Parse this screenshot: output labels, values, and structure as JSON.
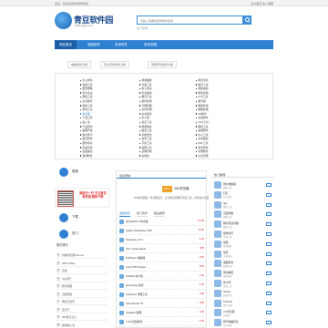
{
  "topbar": {
    "left": "您好，欢迎来到青豆软件园！",
    "right": "设为首页 加入收藏"
  },
  "logo": {
    "name": "青豆软件园",
    "url": "www.qdrjy.com"
  },
  "search": {
    "placeholder": "请输入您要搜索的软件名称"
  },
  "hotwords": "热门搜索：",
  "nav": [
    "网站首页",
    "电脑软件",
    "安卓软件",
    "资讯攻略"
  ],
  "breadcrumb": [
    "电脑软件分类",
    "安卓手机软件分类",
    "苹果手机软件分类"
  ],
  "categories": {
    "col1": [
      "办公软件",
      "系统工具",
      "图形图像",
      "安全杀毒",
      "网络工具",
      "社交聊天",
      "媒体工具",
      "游戏工具",
      "浏览器",
      "下载工具",
      "输入法",
      "行业软件",
      "编程开发",
      "教育学习",
      "股票软件",
      "硬件驱动",
      "压缩刻录",
      "桌面美化",
      "其他软件"
    ],
    "col2": [
      "视频播放",
      "音频工具",
      "电子阅读",
      "影音编辑",
      "翻译工具",
      "邮件处理",
      "日程管理",
      "文件管理",
      "杀毒软件",
      "防火墙",
      "加密工具",
      "数据恢复",
      "磁盘工具",
      "系统优化",
      "备份工具",
      "字体工具",
      "截图工具",
      "远程控制",
      "虚拟机"
    ],
    "col3": [
      "网页浏览",
      "聊天工具",
      "网络电视",
      "网盘存储",
      "FTP工具",
      "服务器",
      "网络检测",
      "图像处理",
      "3D制作",
      "动画制作",
      "CAD工具",
      "图标工具",
      "看图软件",
      "办公工具",
      "文本编辑",
      "PDF工具",
      "财务软件",
      "管理软件",
      "信息管理"
    ],
    "highlight": "浏览器"
  },
  "left": {
    "block1": "搜索",
    "block2": "热门",
    "block3": "下载",
    "qr_text": "微信扫一扫 关注青豆软件园 精彩不断",
    "list_title": "软件排行",
    "list": [
      "谷歌浏览器Chrome",
      "WPS Office",
      "迅雷",
      "QQ音乐",
      "腾讯视频",
      "百度网盘",
      "网易云音乐",
      "爱奇艺",
      "360安全卫士",
      "搜狗输入法"
    ]
  },
  "main": {
    "header": "最近更新",
    "badge": "V3.0",
    "app_name": "360浏览器",
    "desc": "360浏览器是一款功能强大、安全稳定的网页浏览工具，深受用户喜爱。",
    "tabs": [
      "最新软件",
      "热门软件",
      "精品推荐"
    ],
    "rows": [
      {
        "name": "WinRAR 5.0 中文版",
        "size": "12.5M"
      },
      {
        "name": "Adobe Photoshop CS6",
        "size": "210M"
      },
      {
        "name": "Notepad++ 8.4",
        "size": "4.2M"
      },
      {
        "name": "VLC media player",
        "size": "38M"
      },
      {
        "name": "PotPlayer 播放器",
        "size": "26M"
      },
      {
        "name": "Foxit PDF Reader",
        "size": "65M"
      },
      {
        "name": "FileZilla 客户端",
        "size": "11M"
      },
      {
        "name": "Everything 搜索",
        "size": "1.6M"
      },
      {
        "name": "CCleaner 清理工具",
        "size": "24M"
      },
      {
        "name": "TeamViewer 15",
        "size": "30M"
      },
      {
        "name": "Snipaste 截图",
        "size": "14M"
      },
      {
        "name": "7-Zip 压缩软件",
        "size": "1.5M"
      }
    ]
  },
  "right": {
    "header": "热门推荐",
    "rows": [
      {
        "name": "微信电脑版",
        "sub": "聊天工具"
      },
      {
        "name": "钉钉",
        "sub": "办公软件"
      },
      {
        "name": "QQ",
        "sub": "聊天工具"
      },
      {
        "name": "百度网盘",
        "sub": "网络工具"
      },
      {
        "name": "网易有道词典",
        "sub": "翻译工具"
      },
      {
        "name": "酷狗音乐",
        "sub": "音频工具"
      },
      {
        "name": "优酷",
        "sub": "视频播放"
      },
      {
        "name": "快压",
        "sub": "压缩刻录"
      },
      {
        "name": "美图秀秀",
        "sub": "图像处理"
      },
      {
        "name": "驱动精灵",
        "sub": "硬件驱动"
      },
      {
        "name": "鲁大师",
        "sub": "系统工具"
      },
      {
        "name": "Steam",
        "sub": "游戏平台"
      },
      {
        "name": "Foxmail",
        "sub": "邮件处理"
      },
      {
        "name": "UC浏览器",
        "sub": "浏览器"
      },
      {
        "name": "腾讯电脑管家",
        "sub": "安全杀毒"
      }
    ]
  },
  "colors": {
    "accent": "#2d80d2",
    "nav_active": "#1a5fa8",
    "badge": "#f0a12a",
    "size_text": "#dd3333"
  },
  "icons": [
    "globe-logo-icon",
    "search-icon",
    "circle-icon",
    "qr-code-icon",
    "app-icon",
    "download-icon"
  ]
}
